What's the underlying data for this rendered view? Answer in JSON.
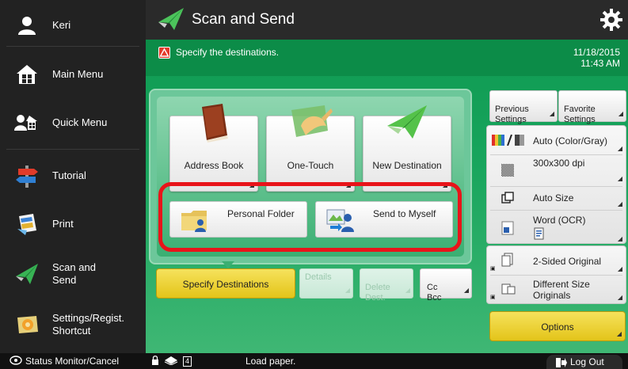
{
  "sidebar": {
    "user": "Keri",
    "items": [
      {
        "label": "Main Menu",
        "icon": "home-icon"
      },
      {
        "label": "Quick Menu",
        "icon": "quick-menu-icon"
      },
      {
        "label": "Tutorial",
        "icon": "signpost-icon"
      },
      {
        "label": "Print",
        "icon": "print-icon"
      },
      {
        "label": "Scan and\nSend",
        "icon": "scan-send-icon"
      },
      {
        "label": "Settings/Regist.\nShortcut",
        "icon": "settings-shortcut-icon"
      }
    ]
  },
  "header": {
    "title": "Scan and Send"
  },
  "message": {
    "text": "Specify the destinations.",
    "date": "11/18/2015",
    "time": "11:43 AM"
  },
  "destinations": {
    "address_book": "Address Book",
    "one_touch": "One-Touch",
    "new_destination": "New Destination",
    "personal_folder": "Personal Folder",
    "send_to_myself": "Send to Myself"
  },
  "actions": {
    "specify_destinations": "Specify Destinations",
    "details": "Details",
    "delete_dest": "Delete\nDest.",
    "cc_bcc": "Cc\nBcc"
  },
  "settings": {
    "previous": "Previous\nSettings",
    "favorite": "Favorite\nSettings",
    "color_mode": "Auto (Color/Gray)",
    "resolution": "300x300 dpi",
    "size": "Auto Size",
    "file_format": "Word (OCR)",
    "two_sided": "2-Sided Original",
    "diff_size": "Different Size\nOriginals",
    "options": "Options"
  },
  "status": {
    "monitor": "Status Monitor/Cancel",
    "paper_count": "4",
    "message": "Load paper.",
    "logout": "Log Out"
  },
  "colors": {
    "green": "#18a55d",
    "highlight": "#e8141a",
    "yellow": "#e8c92a"
  }
}
